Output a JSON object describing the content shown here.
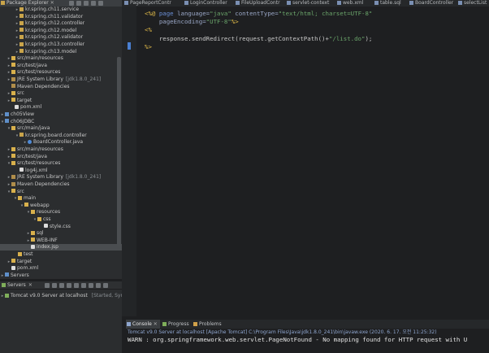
{
  "editor_tabs": [
    {
      "label": "PageReportContr",
      "active": false
    },
    {
      "label": "LoginController",
      "active": false
    },
    {
      "label": "FileUploadContr",
      "active": false
    },
    {
      "label": "servlet-context",
      "active": false
    },
    {
      "label": "web.xml",
      "active": false
    },
    {
      "label": "table.sql",
      "active": false
    },
    {
      "label": "BoardController",
      "active": false
    },
    {
      "label": "selectList.jsp",
      "active": false
    }
  ],
  "explorer": {
    "title": "Package Explorer",
    "items": [
      {
        "label": "kr.spring.ch11.service",
        "icon": "package-icon"
      },
      {
        "label": "kr.spring.ch11.validator",
        "icon": "package-icon"
      },
      {
        "label": "kr.spring.ch12.controller",
        "icon": "package-icon"
      },
      {
        "label": "kr.spring.ch12.model",
        "icon": "package-icon"
      },
      {
        "label": "kr.spring.ch12.validator",
        "icon": "package-icon"
      },
      {
        "label": "kr.spring.ch13.controller",
        "icon": "package-icon"
      },
      {
        "label": "kr.spring.ch13.model",
        "icon": "package-icon"
      },
      {
        "label": "src/main/resources",
        "icon": "folder-icon"
      },
      {
        "label": "src/test/java",
        "icon": "folder-icon"
      },
      {
        "label": "src/test/resources",
        "icon": "folder-icon"
      },
      {
        "label": "JRE System Library",
        "suffix": "[jdk1.8.0_241]",
        "icon": "library-icon"
      },
      {
        "label": "Maven Dependencies",
        "icon": "library-icon"
      },
      {
        "label": "src",
        "icon": "folder-icon"
      },
      {
        "label": "target",
        "icon": "folder-icon"
      },
      {
        "label": "pom.xml",
        "icon": "file-icon"
      },
      {
        "label": "ch05View",
        "icon": "project-icon"
      },
      {
        "label": "ch06JDBC",
        "icon": "project-icon"
      },
      {
        "label": "src/main/java",
        "icon": "folder-icon"
      },
      {
        "label": "kr.spring.board.controller",
        "icon": "package-icon"
      },
      {
        "label": "BoardController.java",
        "icon": "java-file-icon"
      },
      {
        "label": "src/main/resources",
        "icon": "folder-icon"
      },
      {
        "label": "src/test/java",
        "icon": "folder-icon"
      },
      {
        "label": "src/test/resources",
        "icon": "folder-icon"
      },
      {
        "label": "log4j.xml",
        "icon": "file-icon"
      },
      {
        "label": "JRE System Library",
        "suffix": "[jdk1.8.0_241]",
        "icon": "library-icon"
      },
      {
        "label": "Maven Dependencies",
        "icon": "library-icon"
      },
      {
        "label": "src",
        "icon": "folder-icon"
      },
      {
        "label": "main",
        "icon": "folder-icon"
      },
      {
        "label": "webapp",
        "icon": "folder-icon"
      },
      {
        "label": "resources",
        "icon": "folder-icon"
      },
      {
        "label": "css",
        "icon": "folder-icon"
      },
      {
        "label": "style.css",
        "icon": "file-icon"
      },
      {
        "label": "sql",
        "icon": "folder-icon"
      },
      {
        "label": "WEB-INF",
        "icon": "folder-icon"
      },
      {
        "label": "index.jsp",
        "icon": "file-icon",
        "selected": true
      },
      {
        "label": "test",
        "icon": "folder-icon"
      },
      {
        "label": "target",
        "icon": "folder-icon"
      },
      {
        "label": "pom.xml",
        "icon": "file-icon"
      },
      {
        "label": "Servers",
        "icon": "project-icon"
      }
    ]
  },
  "servers": {
    "title": "Servers",
    "entry_label": "Tomcat v9.0 Server at localhost",
    "entry_status": "[Started, Synchron"
  },
  "code": {
    "line1_open": "<%@",
    "line1_kw": "page",
    "line1_attr1": "language=",
    "line1_val1": "\"java\"",
    "line1_attr2": "contentType=",
    "line1_val2": "\"text/html; charset=UTF-8\"",
    "line2_attr": "pageEncoding=",
    "line2_val": "\"UTF-8\"",
    "line2_close": "%>",
    "line3": "<%",
    "line4_pre": "response.sendRedirect(request.getContextPath()+",
    "line4_str": "\"/list.do\"",
    "line4_post": ");",
    "line5": "%>"
  },
  "console": {
    "tabs": [
      {
        "label": "Console",
        "active": true
      },
      {
        "label": "Progress",
        "active": false
      },
      {
        "label": "Problems",
        "active": false
      }
    ],
    "status": "Tomcat v9.0 Server at localhost [Apache Tomcat] C:\\Program Files\\Java\\jdk1.8.0_241\\bin\\javaw.exe (2020. 6. 17. 오전 11:25:32)",
    "output": "WARN : org.springframework.web.servlet.PageNotFound - No mapping found for HTTP request with U"
  },
  "colors": {
    "keyword": "#6a8fd6",
    "string": "#6aa46a",
    "jsp_delim": "#e5be4a",
    "status_blue": "#8fa6cf"
  }
}
